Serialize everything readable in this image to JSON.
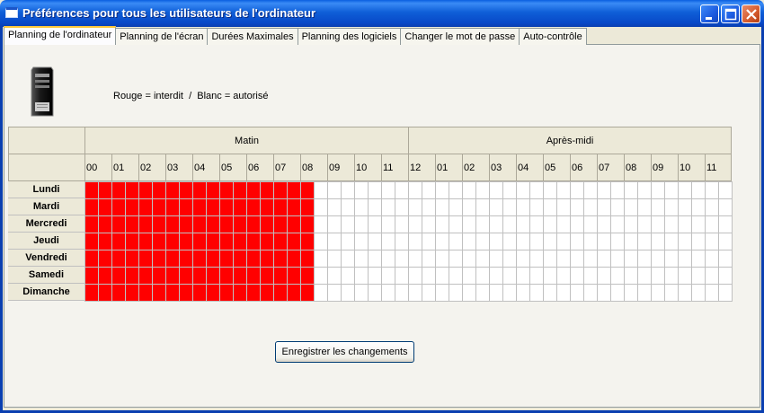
{
  "window": {
    "title": "Préférences pour tous les utilisateurs de l'ordinateur"
  },
  "tabs": [
    {
      "label": "Planning de l'ordinateur",
      "active": true
    },
    {
      "label": "Planning de l'écran",
      "active": false
    },
    {
      "label": "Durées Maximales",
      "active": false
    },
    {
      "label": "Planning des logiciels",
      "active": false
    },
    {
      "label": "Changer le mot de passe",
      "active": false
    },
    {
      "label": "Auto-contrôle",
      "active": false
    }
  ],
  "legend": "Rouge = interdit  /  Blanc = autorisé",
  "schedule": {
    "morning_label": "Matin",
    "afternoon_label": "Après-midi",
    "hours": [
      "00",
      "01",
      "02",
      "03",
      "04",
      "05",
      "06",
      "07",
      "08",
      "09",
      "10",
      "11",
      "12",
      "01",
      "02",
      "03",
      "04",
      "05",
      "06",
      "07",
      "08",
      "09",
      "10",
      "11"
    ],
    "days": [
      "Lundi",
      "Mardi",
      "Mercredi",
      "Jeudi",
      "Vendredi",
      "Samedi",
      "Dimanche"
    ],
    "slots_per_hour": 2,
    "forbidden_until_hour": 8.5,
    "colors": {
      "forbidden": "#ff0000",
      "allowed": "#ffffff",
      "gridline": "#c0c0c0"
    }
  },
  "save_button": "Enregistrer les changements"
}
